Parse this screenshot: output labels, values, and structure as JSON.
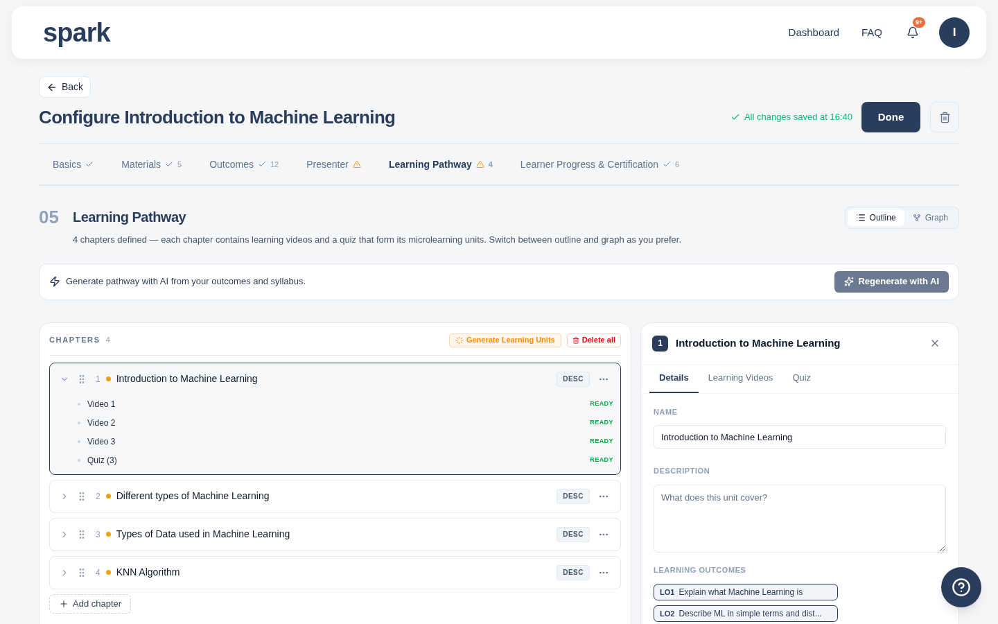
{
  "header": {
    "logo": "spark",
    "nav": [
      "Dashboard",
      "FAQ"
    ],
    "notification_badge": "9+",
    "avatar": "I"
  },
  "back": "Back",
  "title": "Configure Introduction to Machine Learning",
  "save_status": "All changes saved at 16:40",
  "done": "Done",
  "tabs": [
    {
      "label": "Basics",
      "kind": "done",
      "selected": false
    },
    {
      "label": "Materials",
      "kind": "done",
      "count": "5",
      "selected": false
    },
    {
      "label": "Outcomes",
      "kind": "done",
      "count": "12",
      "selected": false
    },
    {
      "label": "Presenter",
      "kind": "warning",
      "selected": false
    },
    {
      "label": "Learning Pathway",
      "kind": "warning",
      "count": "4",
      "selected": true
    },
    {
      "label": "Learner Progress & Certification",
      "kind": "done",
      "count": "6",
      "selected": false
    }
  ],
  "section": {
    "number": "05",
    "title": "Learning Pathway",
    "description": "4 chapters defined — each chapter contains learning videos and a quiz that form its microlearning units. Switch between outline and graph as you prefer.",
    "views": [
      {
        "label": "Outline",
        "kind": "outline",
        "selected": true
      },
      {
        "label": "Graph",
        "kind": "graph",
        "selected": false
      }
    ]
  },
  "ai_banner": {
    "text": "Generate pathway with AI from your outcomes and syllabus.",
    "button": "Regenerate with AI"
  },
  "chapters_panel": {
    "heading": "CHAPTERS",
    "count": "4",
    "generate": "Generate Learning Units",
    "delete_all": "Delete all",
    "add": "Add chapter",
    "chapters": [
      {
        "number": "1",
        "title": "Introduction to Machine Learning",
        "tag": "DESC",
        "expanded": true,
        "selected": true,
        "color": "#f59e0b",
        "units": [
          {
            "label": "Video 1",
            "status": "READY"
          },
          {
            "label": "Video 2",
            "status": "READY"
          },
          {
            "label": "Video 3",
            "status": "READY"
          },
          {
            "label": "Quiz (3)",
            "status": "READY"
          }
        ]
      },
      {
        "number": "2",
        "title": "Different types of Machine Learning",
        "tag": "DESC",
        "expanded": false,
        "selected": false,
        "color": "#f59e0b"
      },
      {
        "number": "3",
        "title": "Types of Data used in Machine Learning",
        "tag": "DESC",
        "expanded": false,
        "selected": false,
        "color": "#f59e0b"
      },
      {
        "number": "4",
        "title": "KNN Algorithm",
        "tag": "DESC",
        "expanded": false,
        "selected": false,
        "color": "#f59e0b"
      }
    ]
  },
  "detail_panel": {
    "badge": "1",
    "title": "Introduction to Machine Learning",
    "tabs": [
      {
        "label": "Details",
        "selected": true
      },
      {
        "label": "Learning Videos",
        "selected": false
      },
      {
        "label": "Quiz",
        "selected": false
      }
    ],
    "name_label": "NAME",
    "name_value": "Introduction to Machine Learning",
    "description_label": "DESCRIPTION",
    "description_placeholder": "What does this unit cover?",
    "outcomes_label": "LEARNING OUTCOMES",
    "outcomes": [
      {
        "code": "LO1",
        "text": "Explain what Machine Learning is"
      },
      {
        "code": "LO2",
        "text": "Describe ML in simple terms and dist..."
      }
    ]
  }
}
